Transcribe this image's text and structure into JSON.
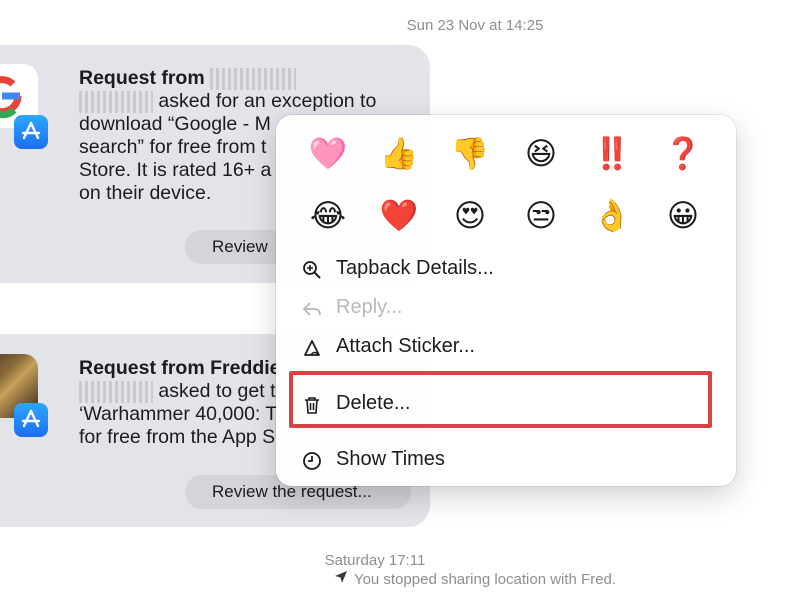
{
  "conversation": {
    "timestamp_top": "Sun 23 Nov at 14:25",
    "timestamp_bottom": "Saturday 17:11",
    "location_note": "You stopped sharing location with Fred."
  },
  "messages": [
    {
      "title": "Request from",
      "lines": [
        "asked for an exception to",
        "download “Google - M",
        "search” for free from t",
        "Store. It is rated 16+ a",
        "on their device."
      ],
      "button": "Review"
    },
    {
      "title": "Request from Freddie",
      "lines": [
        "asked to get t",
        "‘Warhammer 40,000: T",
        "for free from the App S"
      ],
      "button": "Review the request..."
    }
  ],
  "tapbacks": {
    "row1": [
      "🩷",
      "👍",
      "👎",
      "😆",
      "‼️",
      "❓"
    ],
    "row2": [
      "😂",
      "❤️",
      "😍",
      "😒",
      "👌",
      "😀"
    ]
  },
  "menu": {
    "tapback_details": "Tapback Details...",
    "reply": "Reply...",
    "attach_sticker": "Attach Sticker...",
    "delete": "Delete...",
    "show_times": "Show Times"
  },
  "colors": {
    "highlight": "#d64545",
    "badge": "#1a6ff3",
    "bubble": "#e3e3ea"
  }
}
